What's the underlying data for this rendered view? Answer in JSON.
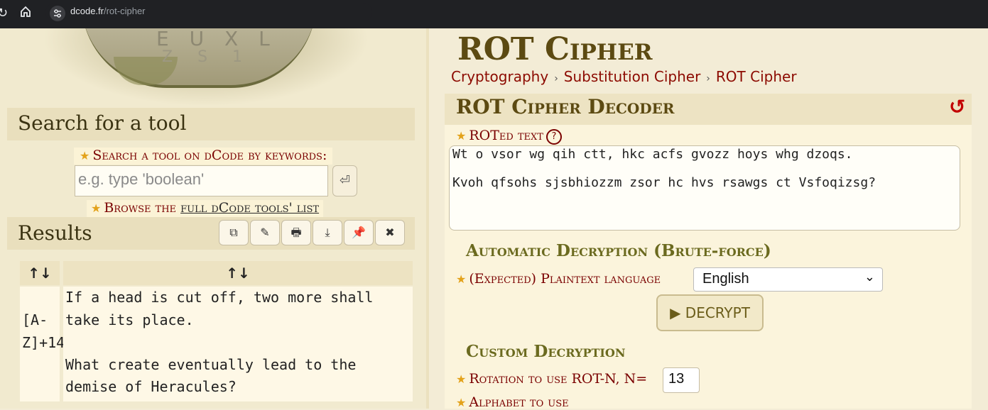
{
  "browser": {
    "url_domain": "dcode.fr",
    "url_path": "/rot-cipher"
  },
  "left": {
    "hero_letters_top": "E U X L",
    "hero_letters_bottom": "Z S 1",
    "search_title": "Search for a tool",
    "keywords_label": "Search a tool on dCode by keywords:",
    "search_placeholder": "e.g. type 'boolean'",
    "enter_glyph": "⏎",
    "browse_prefix": "Browse the ",
    "browse_link": "full dCode tools' list",
    "results_title": "Results",
    "result_tools": [
      "⧉",
      "✎",
      "🖶",
      "⤓",
      "📌",
      "✖"
    ],
    "table": {
      "headers": [
        "↑↓",
        "↑↓"
      ],
      "rows": [
        {
          "key": "[A-Z]+14",
          "value": "If a head is cut off, two more shall take its place.\n\nWhat create eventually lead to the demise of Heracules?"
        }
      ]
    }
  },
  "right": {
    "page_title": "ROT Cipher",
    "breadcrumbs": [
      "Cryptography",
      "Substitution Cipher",
      "ROT Cipher"
    ],
    "crumb_separator": "›",
    "tool_title": "ROT Cipher Decoder",
    "reset_glyph": "↺",
    "roted_label": "ROTed text",
    "help_glyph": "?",
    "roted_text": "Wt o vsor wg qih ctt, hkc acfs gvozz hoys whg dzoqs.\n\nKvoh qfsohs sjsbhiozzm zsor hc hvs rsawgs ct Vsfoqizsg?",
    "auto_heading": "Automatic Decryption (Brute-force)",
    "language_label": "(Expected) Plaintext language",
    "language_value": "English",
    "decrypt_label": "▶ DECRYPT",
    "custom_heading": "Custom Decryption",
    "rotation_label": "Rotation to use ROT-N, N=",
    "rotation_value": "13",
    "alphabet_label": "Alphabet to use"
  },
  "colors": {
    "accent_red": "#7a0000",
    "title_brown": "#5c4a12",
    "subhead_olive": "#6b6a1f",
    "star": "#e3a21a"
  }
}
